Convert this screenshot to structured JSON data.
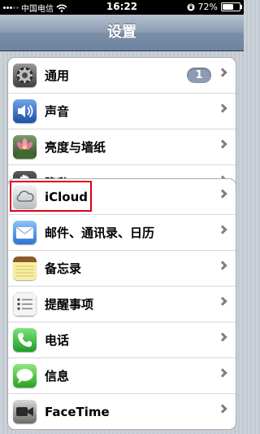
{
  "status_bar": {
    "carrier": "中国电信",
    "time": "16:22",
    "battery": "72%",
    "battery_level": 0.72
  },
  "nav": {
    "title": "设置"
  },
  "group1": [
    {
      "label": "通用",
      "icon": "gear-icon",
      "badge": "1"
    },
    {
      "label": "声音",
      "icon": "speaker-icon"
    },
    {
      "label": "亮度与墙纸",
      "icon": "flower-wallpaper-icon"
    },
    {
      "label": "隐私",
      "icon": "hand-icon"
    }
  ],
  "group2": [
    {
      "label": "iCloud",
      "icon": "cloud-icon",
      "highlighted": true
    },
    {
      "label": "邮件、通讯录、日历",
      "icon": "mail-icon"
    },
    {
      "label": "备忘录",
      "icon": "notes-icon"
    },
    {
      "label": "提醒事项",
      "icon": "reminders-icon"
    },
    {
      "label": "电话",
      "icon": "phone-icon"
    },
    {
      "label": "信息",
      "icon": "messages-icon"
    },
    {
      "label": "FaceTime",
      "icon": "facetime-icon"
    }
  ],
  "colors": {
    "highlight_border": "#e0001b",
    "badge_bg": "#8e9cb3",
    "nav_bg": "#6d83a0"
  }
}
